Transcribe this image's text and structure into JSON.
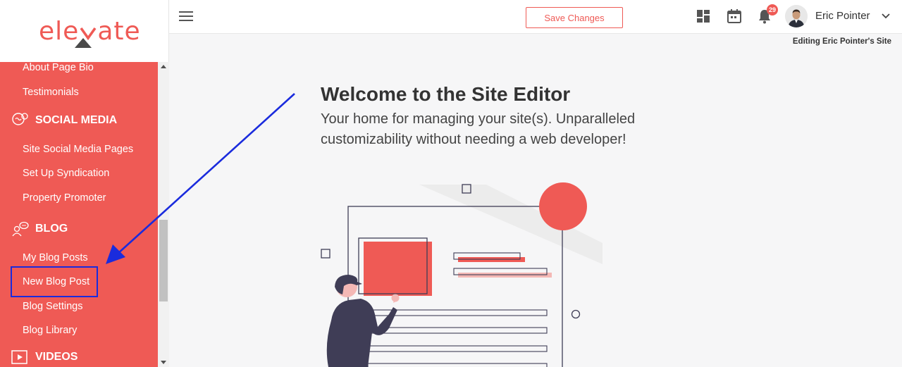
{
  "brand": {
    "logo_text": "ele",
    "logo_text_end": "ate",
    "accent": "#ef5a55"
  },
  "sidebar": {
    "items": [
      {
        "label": "About Page Bio"
      },
      {
        "label": "Testimonials"
      },
      {
        "label": "SOCIAL MEDIA",
        "section": true,
        "icon": "social-media-icon"
      },
      {
        "label": "Site Social Media Pages"
      },
      {
        "label": "Set Up Syndication"
      },
      {
        "label": "Property Promoter"
      },
      {
        "label": "BLOG",
        "section": true,
        "icon": "blog-icon"
      },
      {
        "label": "My Blog Posts"
      },
      {
        "label": "New Blog Post",
        "highlighted": true
      },
      {
        "label": "Blog Settings"
      },
      {
        "label": "Blog Library"
      },
      {
        "label": "VIDEOS",
        "section": true,
        "icon": "video-icon"
      }
    ]
  },
  "header": {
    "save_label": "Save Changes",
    "notification_count": "29",
    "user_name": "Eric Pointer",
    "editing_label": "Editing Eric Pointer's Site",
    "icons": [
      "menu-icon",
      "dashboard-icon",
      "calendar-icon",
      "bell-icon",
      "chevron-down-icon"
    ]
  },
  "main": {
    "title": "Welcome to the Site Editor",
    "subtitle": "Your home for managing your site(s). Unparalleled customizability without needing a web developer!"
  },
  "annotation": {
    "highlight_color": "#1a2bdd",
    "arrow_color": "#1a2bdd"
  }
}
